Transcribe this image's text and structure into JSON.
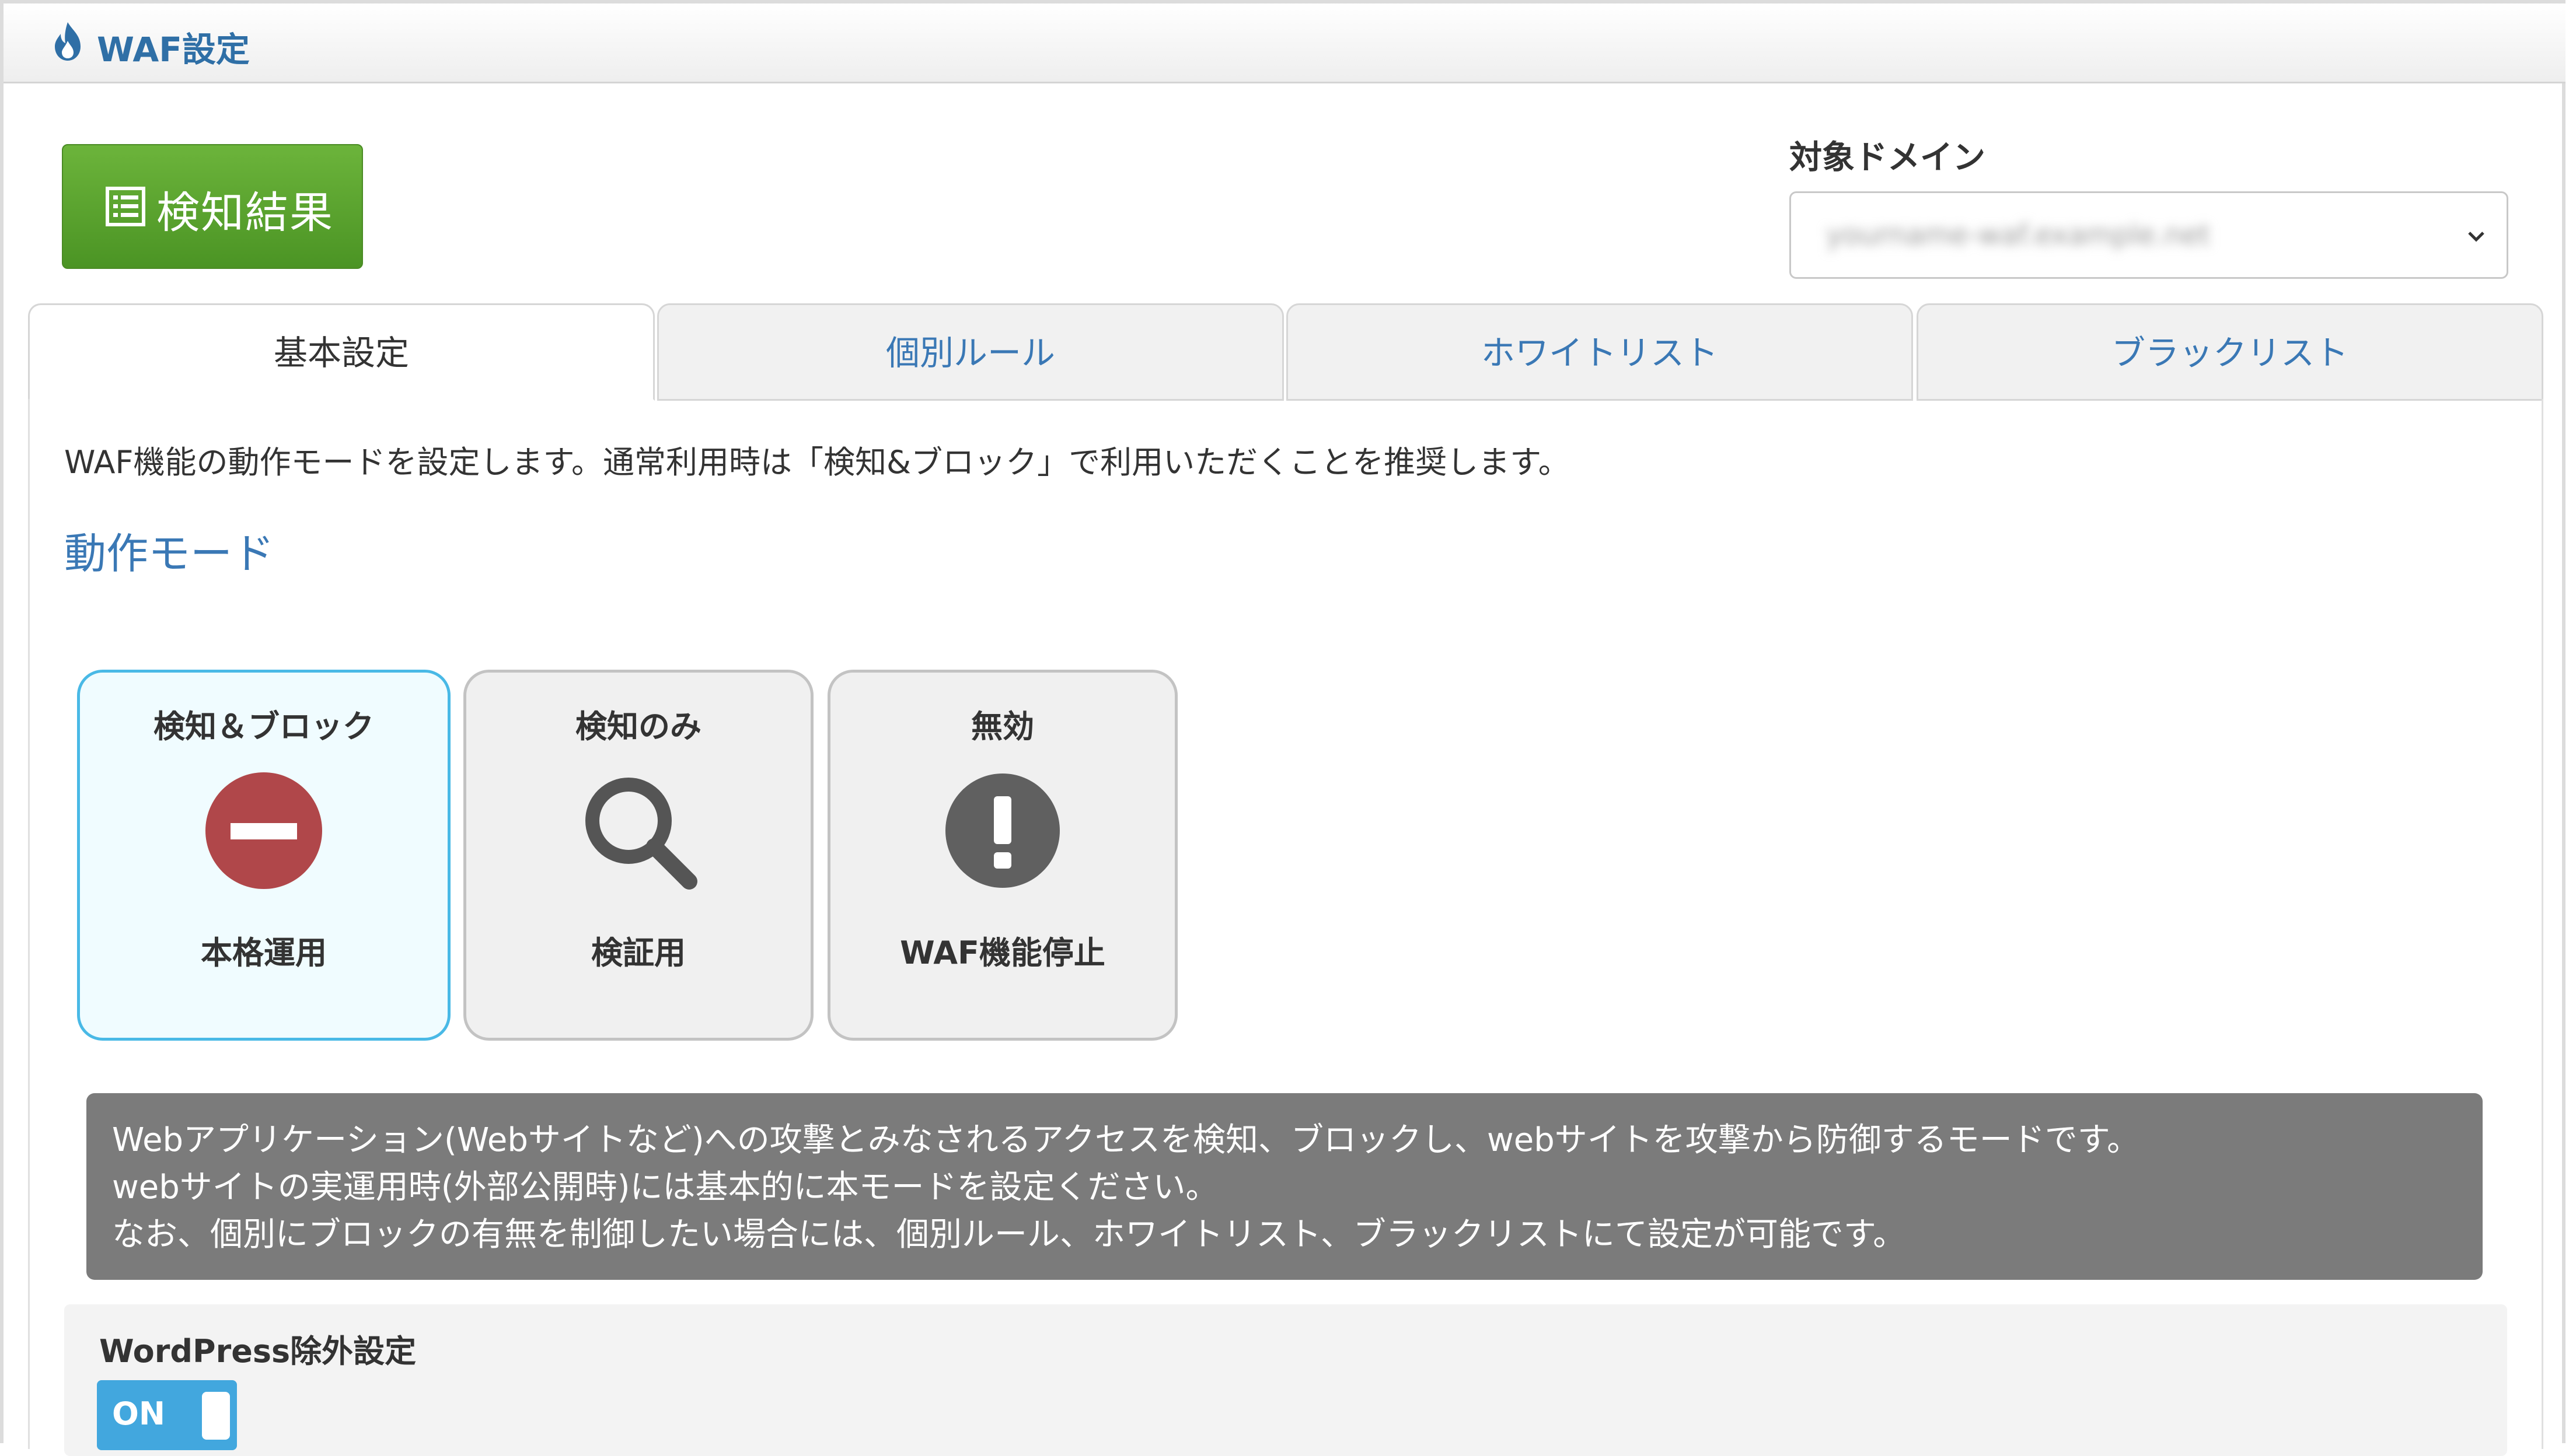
{
  "header": {
    "title": "WAF設定",
    "icon": "fire-icon"
  },
  "results_button": {
    "label": "検知結果",
    "icon": "list-icon",
    "color": "#5aa52f"
  },
  "domain": {
    "label": "対象ドメイン",
    "selected": "yourname-waf.example.net"
  },
  "tabs": [
    {
      "label": "基本設定",
      "active": true
    },
    {
      "label": "個別ルール",
      "active": false
    },
    {
      "label": "ホワイトリスト",
      "active": false
    },
    {
      "label": "ブラックリスト",
      "active": false
    }
  ],
  "description": "WAF機能の動作モードを設定します。通常利用時は「検知&ブロック」で利用いただくことを推奨します。",
  "section_title": "動作モード",
  "modes": [
    {
      "title": "検知＆ブロック",
      "subtitle": "本格運用",
      "icon": "block-icon",
      "selected": true
    },
    {
      "title": "検知のみ",
      "subtitle": "検証用",
      "icon": "search-icon",
      "selected": false
    },
    {
      "title": "無効",
      "subtitle": "WAF機能停止",
      "icon": "exclamation-icon",
      "selected": false
    }
  ],
  "info": {
    "lines": [
      "Webアプリケーション(Webサイトなど)への攻撃とみなされるアクセスを検知、ブロックし、webサイトを攻撃から防御するモードです。",
      "webサイトの実運用時(外部公開時)には基本的に本モードを設定ください。",
      "なお、個別にブロックの有無を制御したい場合には、個別ルール、ホワイトリスト、ブラックリストにて設定が可能です。"
    ]
  },
  "wordpress": {
    "label": "WordPress除外設定",
    "toggle": "ON",
    "toggle_color": "#42a7de"
  },
  "colors": {
    "accent": "#3a78b5",
    "selected_border": "#49b9e6",
    "block_red": "#b0474a"
  }
}
